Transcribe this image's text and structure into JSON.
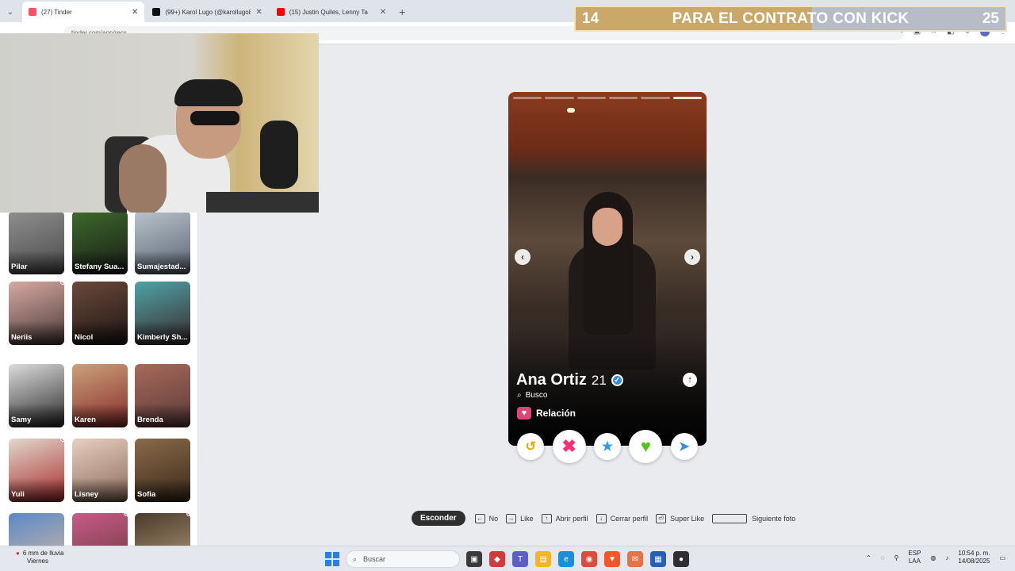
{
  "browser": {
    "tabs": [
      {
        "label": "(27) Tinder",
        "color": "#fd5068"
      },
      {
        "label": "(99+) Karol Lugo (@karollugo8",
        "color": "#111111"
      },
      {
        "label": "(15) Justin Quiles, Lenny Ta",
        "color": "#ff0000"
      }
    ],
    "new_tab": "+",
    "url": "tinder.com/app/recs"
  },
  "banner": {
    "left_number": "14",
    "text": "PARA EL CONTRATO CON KICK",
    "right_number": "25"
  },
  "matches": [
    {
      "name": "Pilar",
      "dot": false,
      "c1": "#8f8f8f",
      "c2": "#4a4a4a"
    },
    {
      "name": "Stefany Sua...",
      "dot": false,
      "c1": "#3d6b2a",
      "c2": "#1a1a1a"
    },
    {
      "name": "Sumajestad...",
      "dot": false,
      "c1": "#b9c4cf",
      "c2": "#5a6470"
    },
    {
      "name": "Neriis",
      "dot": true,
      "c1": "#d7a9a2",
      "c2": "#4a3a3a"
    },
    {
      "name": "Nicol",
      "dot": false,
      "c1": "#6b4a3a",
      "c2": "#1d1515"
    },
    {
      "name": "Kimberly Sh...",
      "dot": false,
      "c1": "#4fa3a8",
      "c2": "#3a2a2a"
    },
    {
      "name": "Samy",
      "dot": false,
      "c1": "#dcdcdc",
      "c2": "#2a2a2a"
    },
    {
      "name": "Karen",
      "dot": false,
      "c1": "#c9a27a",
      "c2": "#8a2a2a"
    },
    {
      "name": "Brenda",
      "dot": false,
      "c1": "#a86a5a",
      "c2": "#5a3a3a"
    },
    {
      "name": "Yuli",
      "dot": true,
      "c1": "#e2d8cc",
      "c2": "#a82a2a"
    },
    {
      "name": "Lisney",
      "dot": false,
      "c1": "#e8cfc0",
      "c2": "#8a6a5a"
    },
    {
      "name": "Sofia",
      "dot": false,
      "c1": "#8a6a4a",
      "c2": "#3a2a1a"
    },
    {
      "name": "",
      "dot": false,
      "c1": "#5a8ac8",
      "c2": "#d8b8a0"
    },
    {
      "name": "",
      "dot": true,
      "c1": "#c85a8a",
      "c2": "#6a3a3a"
    },
    {
      "name": "",
      "dot": true,
      "c1": "#4a3a2a",
      "c2": "#b8a080"
    }
  ],
  "profile": {
    "name": "Ana Ortiz",
    "age": "21",
    "looking_label": "Busco",
    "relation": "Relación",
    "photo_count": 6,
    "photo_index": 6
  },
  "actions": [
    {
      "name": "rewind-button",
      "glyph": "↺",
      "color": "#e0a800",
      "size": "sm"
    },
    {
      "name": "nope-button",
      "glyph": "✖",
      "color": "#ff2d75",
      "size": "lg"
    },
    {
      "name": "super-like-button",
      "glyph": "★",
      "color": "#2f9bf0",
      "size": "sm"
    },
    {
      "name": "like-button",
      "glyph": "♥",
      "color": "#52c41a",
      "size": "lg"
    },
    {
      "name": "boost-button",
      "glyph": "➤",
      "color": "#3a8dde",
      "size": "sm"
    }
  ],
  "shortcuts": {
    "hide": "Esconder",
    "items": [
      {
        "key": "←",
        "label": "No"
      },
      {
        "key": "→",
        "label": "Like"
      },
      {
        "key": "↑",
        "label": "Abrir perfil"
      },
      {
        "key": "↓",
        "label": "Cerrar perfil"
      },
      {
        "key": "⏎",
        "label": "Super Like"
      },
      {
        "key": "",
        "label": "Siguiente foto",
        "wide": true
      }
    ]
  },
  "taskbar": {
    "weather_line1": "6 mm de lluvia",
    "weather_line2": "Viernes",
    "search_placeholder": "Buscar",
    "lang_line1": "ESP",
    "lang_line2": "LAA",
    "time": "10:54 p. m.",
    "date": "14/08/2025"
  }
}
